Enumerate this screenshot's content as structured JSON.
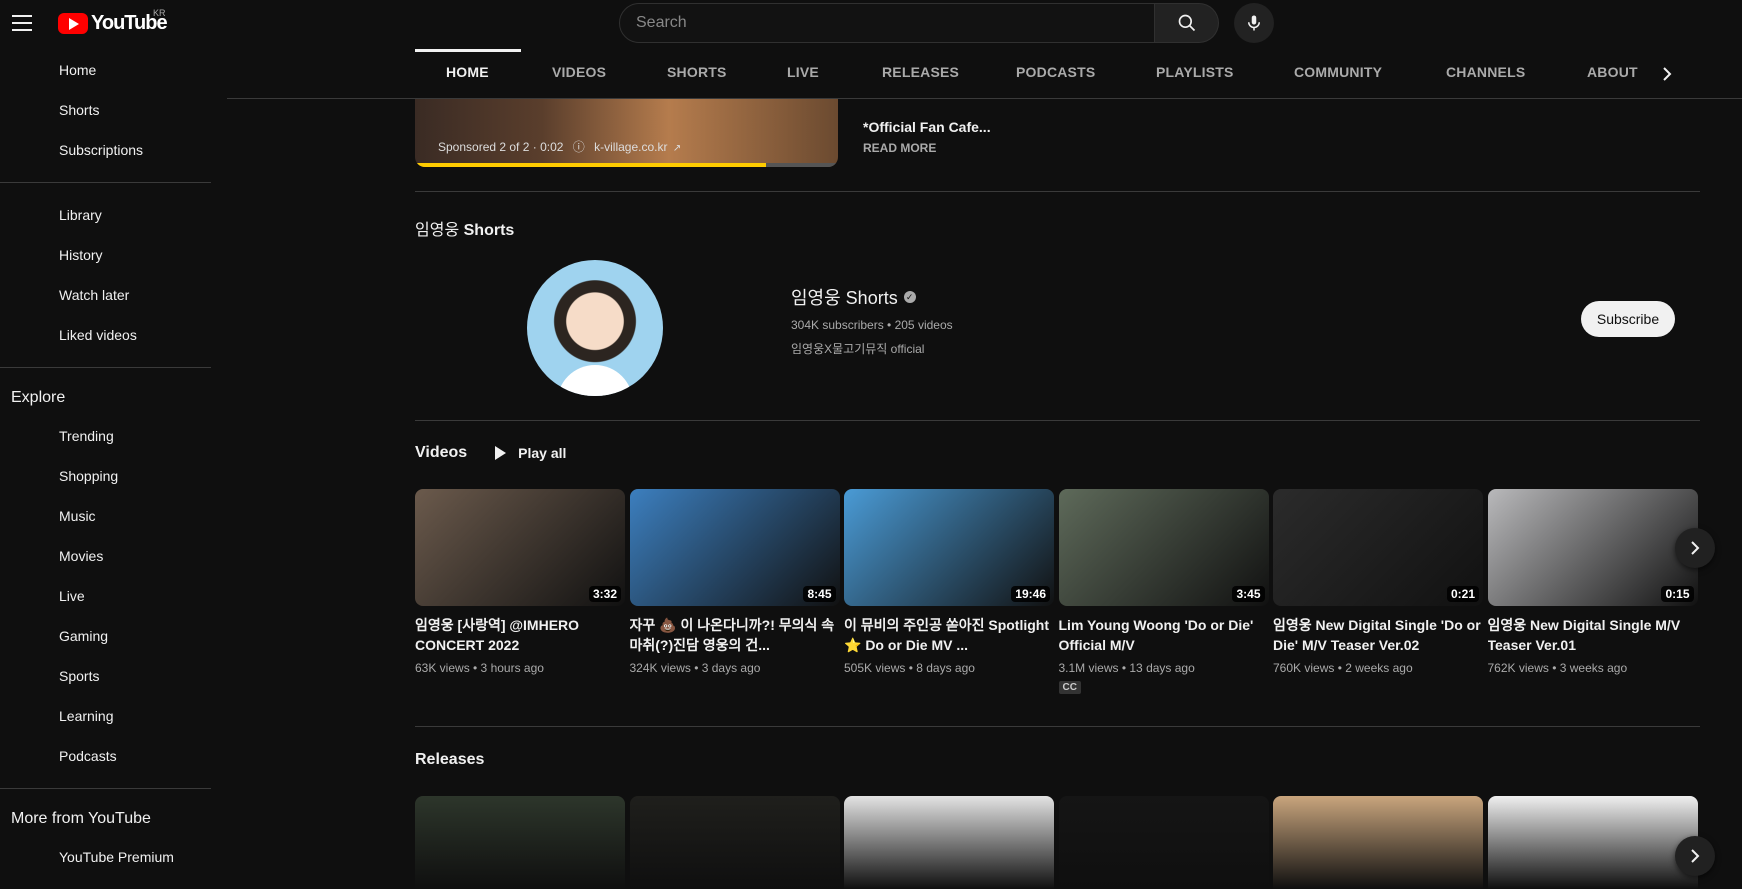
{
  "header": {
    "logo_text": "YouTube",
    "region": "KR",
    "search_placeholder": "Search"
  },
  "sidebar": {
    "main": [
      "Home",
      "Shorts",
      "Subscriptions"
    ],
    "you": [
      "Library",
      "History",
      "Watch later",
      "Liked videos"
    ],
    "explore_heading": "Explore",
    "explore": [
      "Trending",
      "Shopping",
      "Music",
      "Movies",
      "Live",
      "Gaming",
      "Sports",
      "Learning",
      "Podcasts"
    ],
    "more_heading": "More from YouTube",
    "more": [
      "YouTube Premium"
    ]
  },
  "tabs": [
    "HOME",
    "VIDEOS",
    "SHORTS",
    "LIVE",
    "RELEASES",
    "PODCASTS",
    "PLAYLISTS",
    "COMMUNITY",
    "CHANNELS",
    "ABOUT"
  ],
  "ad": {
    "overlay": "Sponsored 2 of 2 · 0:02",
    "domain": "k-village.co.kr",
    "progress": 0.83,
    "side_text": "*Official Fan Cafe...",
    "read_more": "READ MORE"
  },
  "shorts_section": {
    "title_prefix": "임영웅",
    "title_bold": "Shorts",
    "channel_name": "임영웅 Shorts",
    "meta": "304K subscribers • 205 videos",
    "description": "임영웅X물고기뮤직 official",
    "subscribe_label": "Subscribe"
  },
  "videos_section": {
    "title": "Videos",
    "play_all": "Play all",
    "items": [
      {
        "title": "임영웅 [사랑역] @IMHERO CONCERT 2022",
        "meta": "63K views • 3 hours ago",
        "duration": "3:32",
        "color": "#6b5a4c"
      },
      {
        "title": "자꾸 💩 이 나온다니까?! 무의식 속 마취(?)진담 영웅의 건...",
        "meta": "324K views • 3 days ago",
        "duration": "8:45",
        "color": "#3c7fbf"
      },
      {
        "title": "이 뮤비의 주인공 쏟아진 Spotlight ⭐ Do or Die MV ...",
        "meta": "505K views • 8 days ago",
        "duration": "19:46",
        "color": "#4a9bd6"
      },
      {
        "title": "Lim Young Woong 'Do or Die' Official M/V",
        "meta": "3.1M views • 13 days ago",
        "duration": "3:45",
        "color": "#5e6a5a",
        "badge": "CC"
      },
      {
        "title": "임영웅 New Digital Single 'Do or Die' M/V Teaser Ver.02",
        "meta": "760K views • 2 weeks ago",
        "duration": "0:21",
        "color": "#2b2b2b"
      },
      {
        "title": "임영웅 New Digital Single M/V Teaser Ver.01",
        "meta": "762K views • 3 weeks ago",
        "duration": "0:15",
        "color": "#b9b9bb"
      }
    ]
  },
  "releases_section": {
    "title": "Releases",
    "colors": [
      "#2d362b",
      "#1f1f1c",
      "#e3e3e3",
      "#151515",
      "#c9a57d",
      "#efefef"
    ]
  }
}
